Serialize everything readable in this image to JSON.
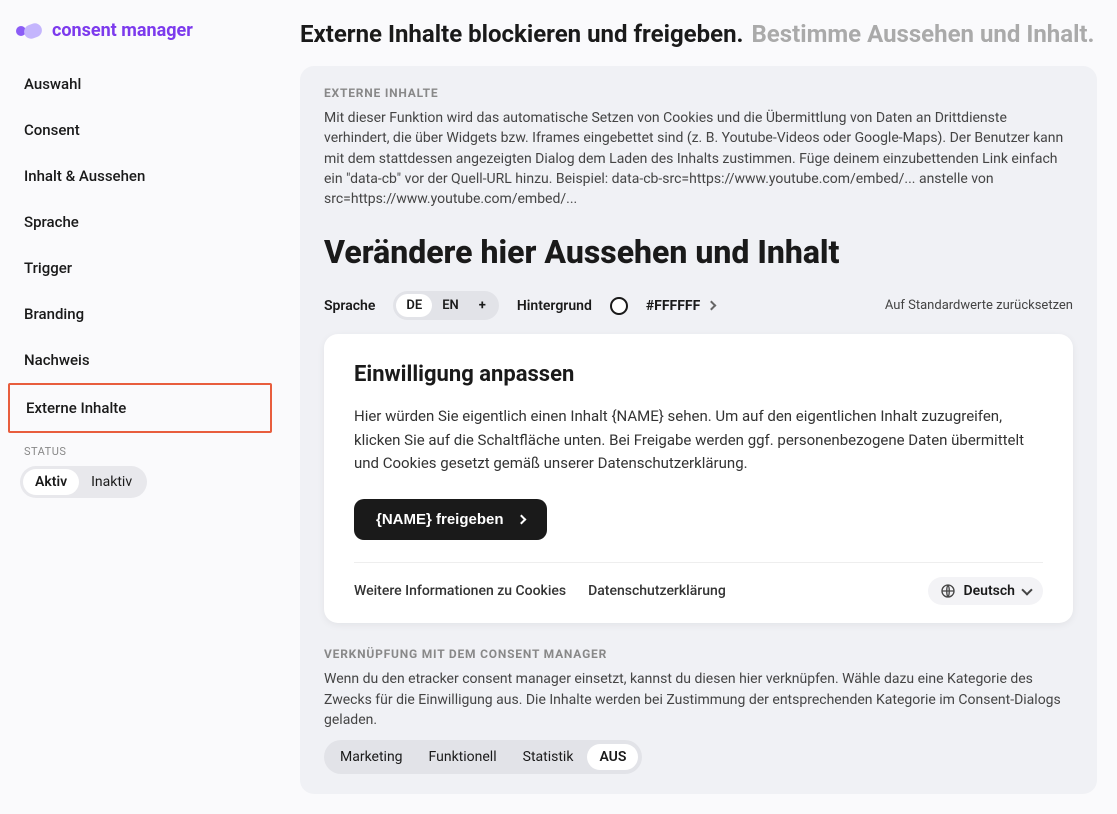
{
  "logo": {
    "text": "consent manager"
  },
  "nav": {
    "items": [
      "Auswahl",
      "Consent",
      "Inhalt & Aussehen",
      "Sprache",
      "Trigger",
      "Branding",
      "Nachweis",
      "Externe Inhalte"
    ],
    "activeIndex": 7
  },
  "status": {
    "label": "STATUS",
    "active": "Aktiv",
    "inactive": "Inaktiv"
  },
  "header": {
    "title": "Externe Inhalte blockieren und freigeben.",
    "subtitle": "Bestimme Aussehen und Inhalt."
  },
  "section1": {
    "label": "EXTERNE INHALTE",
    "text": "Mit dieser Funktion wird das automatische Setzen von Cookies und die Übermittlung von Daten an Drittdienste verhindert, die über Widgets bzw. Iframes eingebettet sind (z. B. Youtube-Videos oder Google-Maps). Der Benutzer kann mit dem stattdessen angezeigten Dialog dem Laden des Inhalts zustimmen. Füge deinem einzubettenden Link einfach ein \"data-cb\" vor der Quell-URL hinzu. Beispiel: data-cb-src=https://www.youtube.com/embed/... anstelle von src=https://www.youtube.com/embed/..."
  },
  "config": {
    "title": "Verändere hier Aussehen und Inhalt",
    "langLabel": "Sprache",
    "langs": {
      "de": "DE",
      "en": "EN",
      "add": "+"
    },
    "bgLabel": "Hintergrund",
    "bgValue": "#FFFFFF",
    "resetLabel": "Auf Standardwerte zurücksetzen"
  },
  "preview": {
    "title": "Einwilligung anpassen",
    "body": "Hier würden Sie eigentlich einen Inhalt {NAME} sehen. Um auf den eigentlichen Inhalt zuzugreifen, klicken Sie auf die Schaltfläche unten. Bei Freigabe werden ggf. personenbezogene Daten übermittelt und Cookies gesetzt gemäß unserer Datenschutzerklärung.",
    "button": "{NAME} freigeben",
    "linkCookies": "Weitere Informationen zu Cookies",
    "linkPrivacy": "Datenschutzerklärung",
    "langSelect": "Deutsch"
  },
  "section2": {
    "label": "VERKNÜPFUNG MIT DEM CONSENT MANAGER",
    "text": "Wenn du den etracker consent manager einsetzt, kannst du diesen hier verknüpfen. Wähle dazu eine Kategorie des Zwecks für die Einwilligung aus. Die Inhalte werden bei Zustimmung der entsprechenden Kategorie im Consent-Dialogs geladen.",
    "cats": {
      "marketing": "Marketing",
      "funktionell": "Funktionell",
      "statistik": "Statistik",
      "aus": "AUS"
    }
  }
}
